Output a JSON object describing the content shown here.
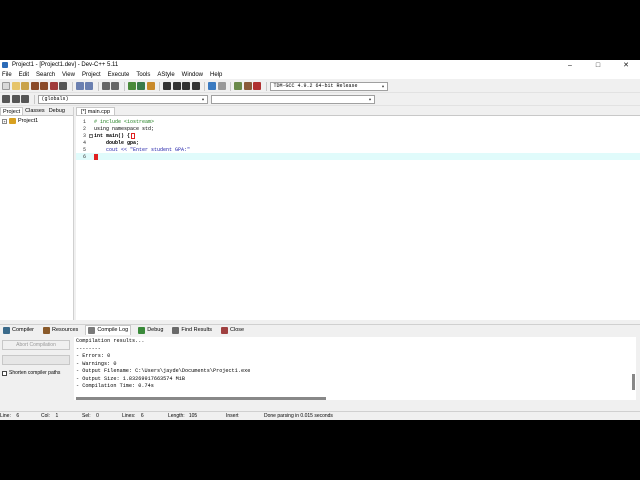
{
  "window": {
    "title": "Project1 - [Project1.dev] - Dev-C++ 5.11",
    "minimize": "–",
    "maximize": "□",
    "close": "✕"
  },
  "menu": [
    "File",
    "Edit",
    "Search",
    "View",
    "Project",
    "Execute",
    "Tools",
    "AStyle",
    "Window",
    "Help"
  ],
  "toolbar": {
    "compiler": "TDM-GCC 4.9.2 64-bit Release",
    "scope": "(globals)"
  },
  "left_panel": {
    "tabs": [
      "Project",
      "Classes",
      "Debug"
    ],
    "tree_root": "Project1"
  },
  "editor": {
    "tab": "[*] main.cpp",
    "lines": [
      {
        "num": "1",
        "text": "# include <iostream>"
      },
      {
        "num": "2",
        "text": "using namespace std;"
      },
      {
        "num": "3",
        "text": "int main() {"
      },
      {
        "num": "4",
        "text": "    double gpa;"
      },
      {
        "num": "5",
        "text": "    cout << \"Enter student GPA:\""
      },
      {
        "num": "6",
        "text": ""
      }
    ]
  },
  "bottom_tabs": [
    "Compiler",
    "Resources",
    "Compile Log",
    "Debug",
    "Find Results",
    "Close"
  ],
  "compile_panel": {
    "abort_label": "Abort Compilation",
    "shorten_label": "Shorten compiler paths",
    "log": [
      "Compilation results...",
      "--------",
      "- Errors: 0",
      "- Warnings: 0",
      "- Output Filename: C:\\Users\\jayde\\Documents\\Project1.exe",
      "- Output Size: 1.83269917663574 MiB",
      "- Compilation Time: 0.74s"
    ]
  },
  "status": {
    "line": "Line:    6",
    "col": "Col:    1",
    "sel": "Sel:    0",
    "lines": "Lines:    6",
    "length": "Length:   105",
    "mode": "Insert",
    "message": "Done parsing in 0.015 seconds"
  },
  "colors": {
    "current_line": "#e0fbfb",
    "preprocessor": "#1f7f1f",
    "string": "#1a1aa6",
    "caret": "#e02020"
  }
}
